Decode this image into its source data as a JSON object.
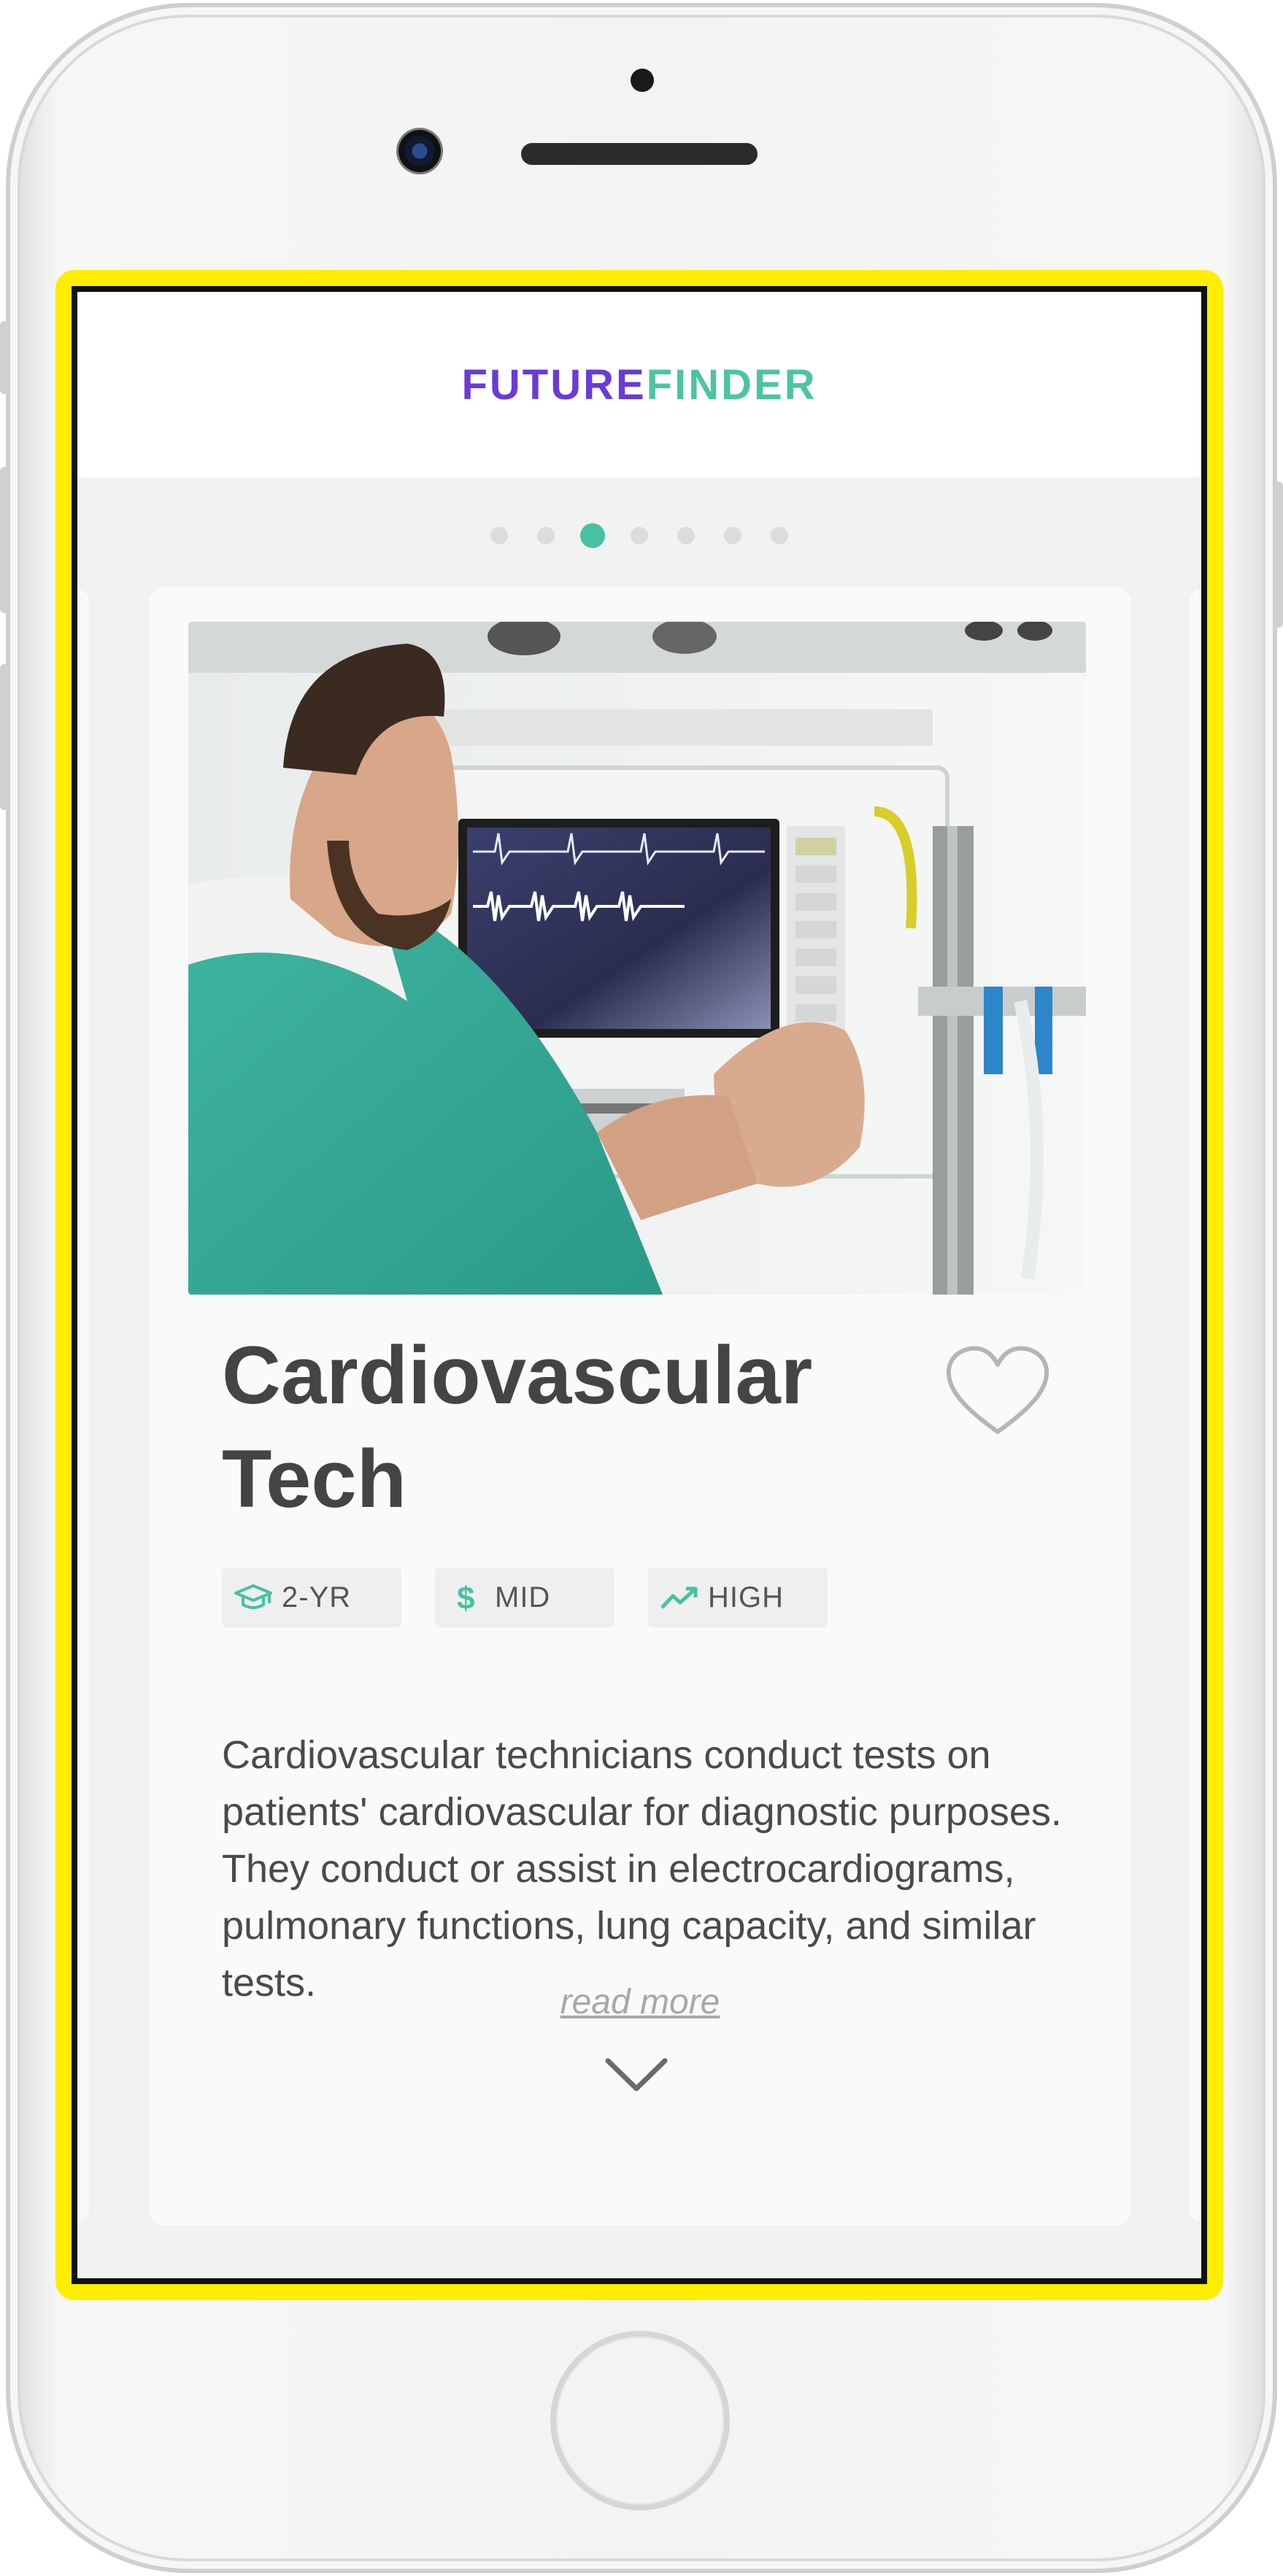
{
  "app": {
    "brand_part1": "FUTURE",
    "brand_part2": "FINDER",
    "brand_color_1": "#6a3bd8",
    "brand_color_2": "#4cc4a4"
  },
  "carousel": {
    "total_dots": 7,
    "active_index": 2,
    "active_color": "#47c1a2"
  },
  "card": {
    "title_line1": "Cardiovascular",
    "title_line2": "Tech",
    "image_alt": "technician operating a cardiac monitor",
    "favorite_icon": "heart-outline-icon",
    "tags": [
      {
        "icon": "graduation-cap-icon",
        "label": "2-YR"
      },
      {
        "icon": "dollar-icon",
        "label": "MID"
      },
      {
        "icon": "trend-up-icon",
        "label": "HIGH"
      }
    ],
    "description": "Cardiovascular technicians conduct tests on patients' cardiovascular for diagnostic purposes. They conduct or assist in electrocardiograms, pulmonary functions, lung capacity, and similar tests.",
    "read_more": "read more",
    "expand_icon": "chevron-down-icon"
  },
  "device": {
    "frame_color": "#f2f3f3",
    "highlight_color": "#ffee00"
  }
}
